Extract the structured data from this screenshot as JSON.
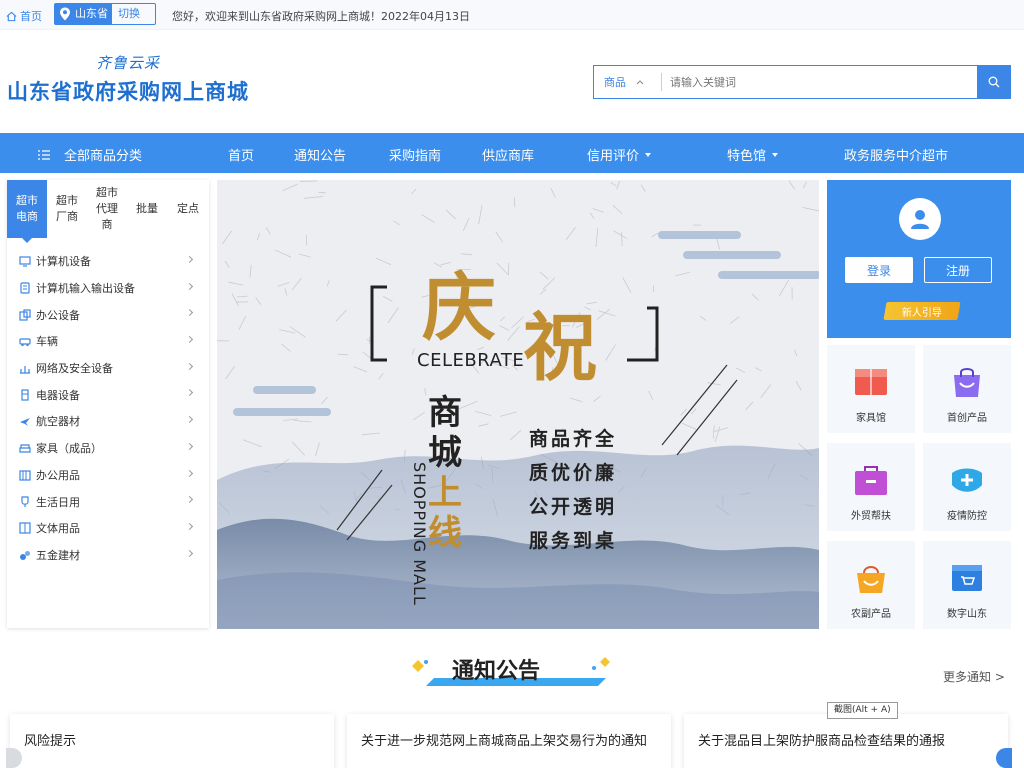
{
  "topbar": {
    "home_label": "首页",
    "province": "山东省",
    "switch_label": "切换",
    "welcome": "您好，欢迎来到山东省政府采购网上商城！2022年04月13日"
  },
  "header": {
    "slogan": "齐鲁云采",
    "site_name": "山东省政府采购网上商城",
    "search_category": "商品",
    "search_placeholder": "请输入关键词"
  },
  "nav": {
    "all_categories": "全部商品分类",
    "items": [
      {
        "label": "首页"
      },
      {
        "label": "通知公告"
      },
      {
        "label": "采购指南"
      },
      {
        "label": "供应商库"
      },
      {
        "label": "信用评价"
      },
      {
        "label": "特色馆"
      },
      {
        "label": "政务服务中介超市"
      }
    ]
  },
  "left_tabs": [
    {
      "label": "超市电商"
    },
    {
      "label": "超市厂商"
    },
    {
      "label": "超市代理商"
    },
    {
      "label": "批量"
    },
    {
      "label": "定点"
    }
  ],
  "categories": [
    {
      "label": "计算机设备",
      "icon": "monitor-icon"
    },
    {
      "label": "计算机输入输出设备",
      "icon": "printer-icon"
    },
    {
      "label": "办公设备",
      "icon": "office-icon"
    },
    {
      "label": "车辆",
      "icon": "car-icon"
    },
    {
      "label": "网络及安全设备",
      "icon": "network-icon"
    },
    {
      "label": "电器设备",
      "icon": "appliance-icon"
    },
    {
      "label": "航空器材",
      "icon": "plane-icon"
    },
    {
      "label": "家具（成品）",
      "icon": "sofa-icon"
    },
    {
      "label": "办公用品",
      "icon": "supplies-icon"
    },
    {
      "label": "生活日用",
      "icon": "daily-icon"
    },
    {
      "label": "文体用品",
      "icon": "book-icon"
    },
    {
      "label": "五金建材",
      "icon": "tools-icon"
    }
  ],
  "banner": {
    "big1": "庆",
    "big2": "祝",
    "celebrate": "CELEBRATE",
    "shop1": "商",
    "shop2": "城",
    "shop3": "上",
    "shop4": "线",
    "shopping_mall": "SHOPPING MALL",
    "line1": "商品齐全",
    "line2": "质优价廉",
    "line3": "公开透明",
    "line4": "服务到桌"
  },
  "login": {
    "login_label": "登录",
    "register_label": "注册",
    "guide_label": "新人引导"
  },
  "tiles": [
    {
      "label": "家具馆",
      "color": "#f05a4f"
    },
    {
      "label": "首创产品",
      "color": "#8b6cf0"
    },
    {
      "label": "外贸帮扶",
      "color": "#c04fd6"
    },
    {
      "label": "疫情防控",
      "color": "#2fa8e8"
    },
    {
      "label": "农副产品",
      "color": "#f5a623"
    },
    {
      "label": "数字山东",
      "color": "#2d7fe0"
    }
  ],
  "notices": {
    "title": "通知公告",
    "more": "更多通知 >",
    "tooltip": "截图(Alt + A)",
    "cards": [
      {
        "title": "风险提示"
      },
      {
        "title": "关于进一步规范网上商城商品上架交易行为的通知"
      },
      {
        "title": "关于混品目上架防护服商品检查结果的通报"
      }
    ]
  },
  "colors": {
    "primary": "#3b86e6",
    "nav": "#3b8eec",
    "gold": "#c9962a"
  }
}
